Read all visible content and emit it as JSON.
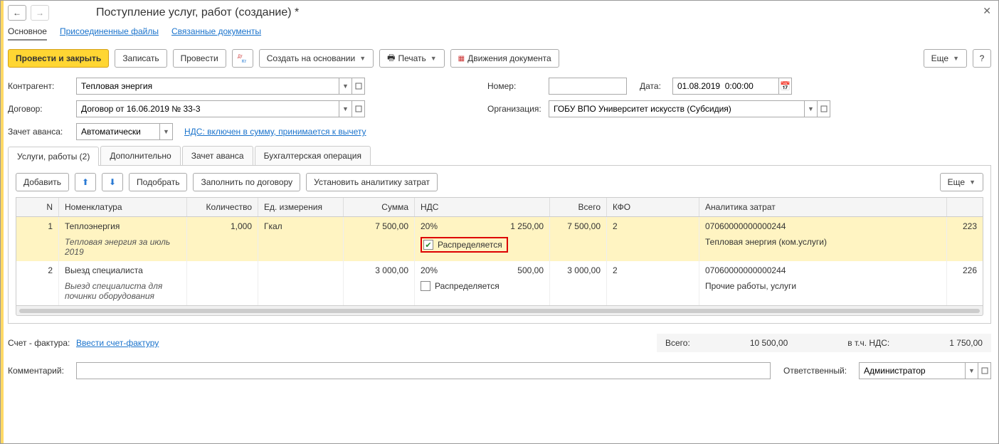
{
  "window": {
    "title": "Поступление услуг, работ (создание) *"
  },
  "topTabs": {
    "main": "Основное",
    "files": "Присоединенные файлы",
    "related": "Связанные документы"
  },
  "toolbar": {
    "postClose": "Провести и закрыть",
    "save": "Записать",
    "post": "Провести",
    "createBased": "Создать на основании",
    "print": "Печать",
    "movements": "Движения документа",
    "more": "Еще",
    "help": "?"
  },
  "fields": {
    "counterpartyLabel": "Контрагент:",
    "counterparty": "Тепловая энергия",
    "contractLabel": "Договор:",
    "contract": "Договор от 16.06.2019 № 33-3",
    "advanceLabel": "Зачет аванса:",
    "advance": "Автоматически",
    "vatLink": "НДС: включен в сумму, принимается к вычету",
    "numberLabel": "Номер:",
    "number": "",
    "dateLabel": "Дата:",
    "date": "01.08.2019  0:00:00",
    "orgLabel": "Организация:",
    "org": "ГОБУ ВПО Университет искусств (Субсидия)"
  },
  "innerTabs": {
    "services": "Услуги, работы (2)",
    "extra": "Дополнительно",
    "advance": "Зачет аванса",
    "accounting": "Бухгалтерская операция"
  },
  "subToolbar": {
    "add": "Добавить",
    "pick": "Подобрать",
    "fillContract": "Заполнить по договору",
    "setAnalytics": "Установить аналитику затрат",
    "more": "Еще"
  },
  "gridHead": {
    "n": "N",
    "nom": "Номенклатура",
    "qty": "Количество",
    "unit": "Ед. измерения",
    "sum": "Сумма",
    "vat": "НДС",
    "total": "Всего",
    "kfo": "КФО",
    "an": "Аналитика затрат"
  },
  "rows": [
    {
      "n": "1",
      "nom": "Теплоэнергия",
      "desc": "Тепловая энергия за июль 2019",
      "qty": "1,000",
      "unit": "Гкал",
      "sum": "7 500,00",
      "vatRate": "20%",
      "vatAmount": "1 250,00",
      "distributed": true,
      "distributedLabel": "Распределяется",
      "total": "7 500,00",
      "kfo": "2",
      "an1": "07060000000000244",
      "an2": "Тепловая энергия (ком.услуги)",
      "code": "223",
      "selected": true,
      "highlightChk": true
    },
    {
      "n": "2",
      "nom": "Выезд специалиста",
      "desc": "Выезд специалиста для починки оборудования",
      "qty": "",
      "unit": "",
      "sum": "3 000,00",
      "vatRate": "20%",
      "vatAmount": "500,00",
      "distributed": false,
      "distributedLabel": "Распределяется",
      "total": "3 000,00",
      "kfo": "2",
      "an1": "07060000000000244",
      "an2": "Прочие работы, услуги",
      "code": "226",
      "selected": false,
      "highlightChk": false
    }
  ],
  "footer": {
    "invoiceLabel": "Счет - фактура:",
    "invoiceLink": "Ввести счет-фактуру",
    "totalLabel": "Всего:",
    "total": "10 500,00",
    "vatInclLabel": "в т.ч. НДС:",
    "vatIncl": "1 750,00",
    "commentLabel": "Комментарий:",
    "comment": "",
    "responsibleLabel": "Ответственный:",
    "responsible": "Администратор"
  }
}
